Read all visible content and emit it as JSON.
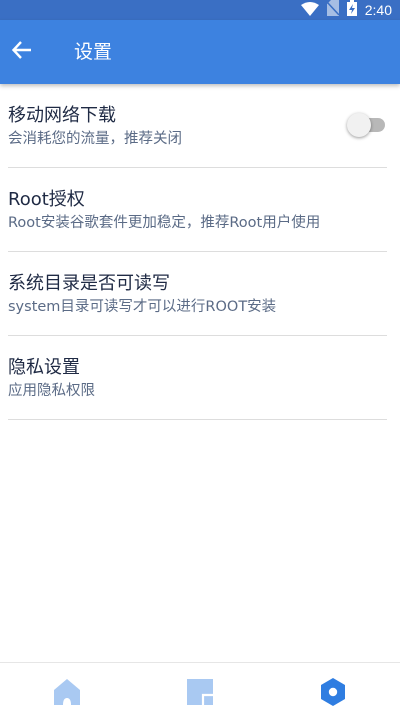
{
  "status_bar": {
    "time": "2:40",
    "icons": [
      "wifi-icon",
      "no-sim-icon",
      "battery-charging-icon"
    ]
  },
  "app_bar": {
    "back_icon": "arrow-left-icon",
    "title": "设置"
  },
  "settings": [
    {
      "title": "移动网络下载",
      "description": "会消耗您的流量，推荐关闭",
      "toggle": {
        "on": false
      }
    },
    {
      "title": "Root授权",
      "description": "Root安装谷歌套件更加稳定，推荐Root用户使用"
    },
    {
      "title": "系统目录是否可读写",
      "description": "system目录可读写才可以进行ROOT安装"
    },
    {
      "title": "隐私设置",
      "description": "应用隐私权限"
    }
  ],
  "bottom_nav": {
    "tabs": [
      {
        "icon": "home-icon",
        "active": false
      },
      {
        "icon": "file-icon",
        "active": false
      },
      {
        "icon": "settings-hexagon-icon",
        "active": true
      }
    ]
  },
  "colors": {
    "app_bar": "#3d82e0",
    "status_bar": "#3a6fc4",
    "nav_inactive": "#a9c9f2",
    "nav_active": "#2f7de1"
  }
}
